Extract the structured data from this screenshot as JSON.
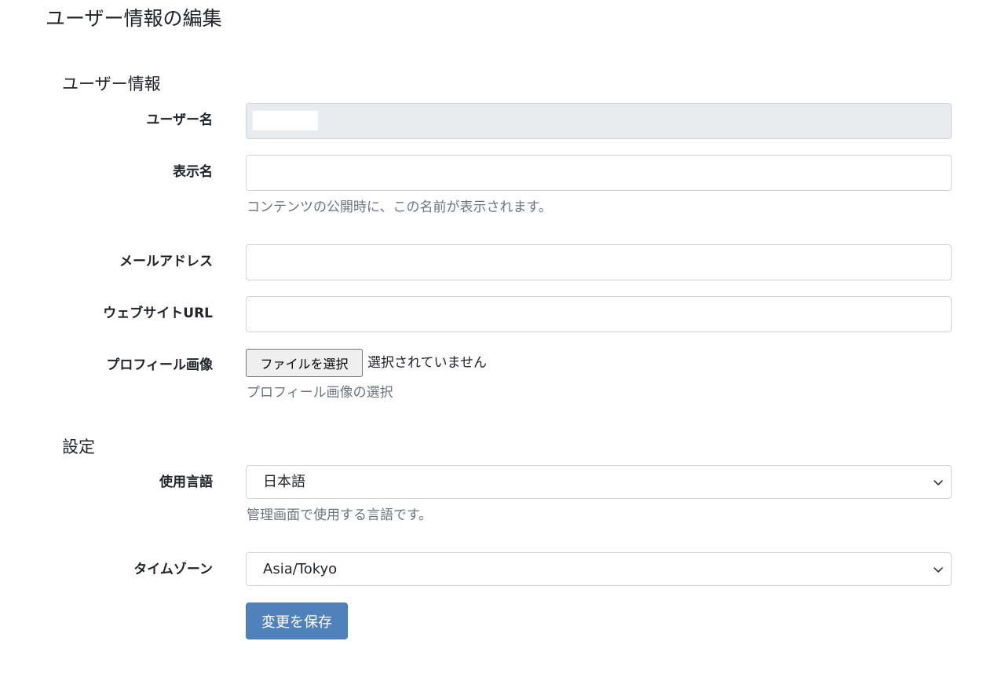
{
  "page_title": "ユーザー情報の編集",
  "sections": {
    "user_info": {
      "title": "ユーザー情報",
      "username_label": "ユーザー名",
      "username_value": "",
      "display_name_label": "表示名",
      "display_name_value": "",
      "display_name_help": "コンテンツの公開時に、この名前が表示されます。",
      "email_label": "メールアドレス",
      "email_value": "",
      "website_label": "ウェブサイトURL",
      "website_value": "",
      "profile_image_label": "プロフィール画像",
      "file_button_label": "ファイルを選択",
      "file_status": "選択されていません",
      "profile_image_help": "プロフィール画像の選択"
    },
    "settings": {
      "title": "設定",
      "language_label": "使用言語",
      "language_selected": "日本語",
      "language_help": "管理画面で使用する言語です。",
      "timezone_label": "タイムゾーン",
      "timezone_selected": "Asia/Tokyo"
    }
  },
  "save_button_label": "変更を保存",
  "colors": {
    "primary_button": "#4f81bd",
    "readonly_bg": "#e9ecef",
    "border": "#ced4da",
    "help_text": "#6c757d"
  },
  "icons": {
    "select_chevron": "chevron-down-icon"
  }
}
